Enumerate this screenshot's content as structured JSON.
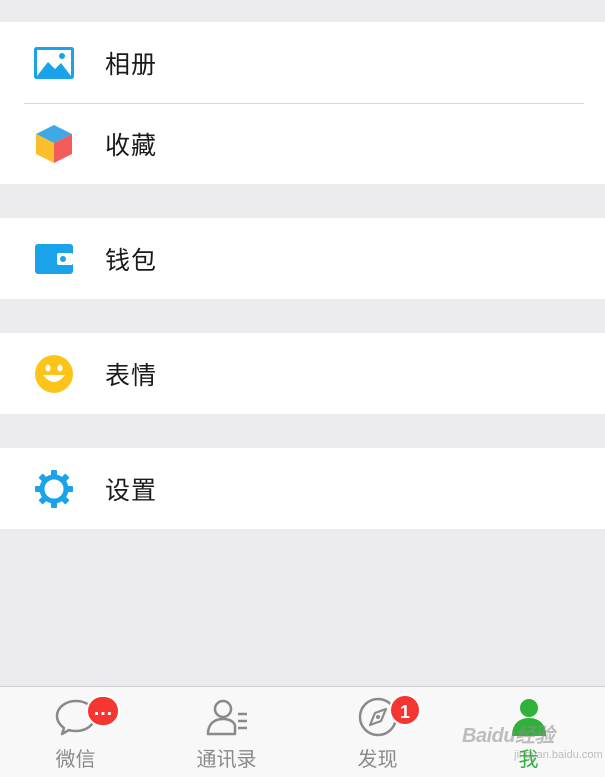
{
  "menu": {
    "album": {
      "label": "相册",
      "icon": "album-icon"
    },
    "favorites": {
      "label": "收藏",
      "icon": "favorites-cube-icon"
    },
    "wallet": {
      "label": "钱包",
      "icon": "wallet-icon"
    },
    "stickers": {
      "label": "表情",
      "icon": "smiley-icon"
    },
    "settings": {
      "label": "设置",
      "icon": "gear-icon"
    }
  },
  "tabs": [
    {
      "label": "微信",
      "icon": "chat-bubble-icon",
      "badge": "…"
    },
    {
      "label": "通讯录",
      "icon": "contacts-icon",
      "badge": ""
    },
    {
      "label": "发现",
      "icon": "compass-icon",
      "badge": "1"
    },
    {
      "label": "我",
      "icon": "me-person-icon",
      "badge": "",
      "active": true
    }
  ],
  "watermark": {
    "text": "Baidu经验",
    "sub": "jingyan.baidu.com"
  },
  "colors": {
    "accent_blue": "#1aa3e8",
    "badge_red": "#f43530",
    "active_green": "#2fb13a",
    "smiley_yellow": "#fcc419",
    "background": "#ebebee"
  }
}
